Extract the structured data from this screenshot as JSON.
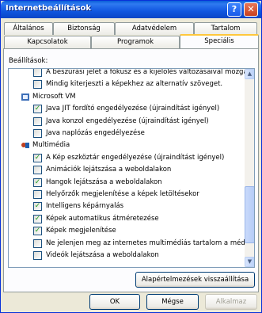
{
  "window": {
    "title": "Internetbeállítások"
  },
  "titlebar_buttons": {
    "help": "?",
    "close": "✕"
  },
  "tabs_row1": [
    "Általános",
    "Biztonság",
    "Adatvédelem",
    "Tartalom"
  ],
  "tabs_row2": [
    "Kapcsolatok",
    "Programok",
    "Speciális"
  ],
  "active_tab": "Speciális",
  "settings": {
    "label": "Beállítások:",
    "rows": [
      {
        "type": "checkbox",
        "checked": false,
        "text": "A beszúrási jelet a fókusz és a kijelölés változásaival mozgatja"
      },
      {
        "type": "checkbox",
        "checked": false,
        "text": "Mindig kiterjeszti a képekhez az alternatív szöveget."
      },
      {
        "type": "category",
        "icon": "java-icon",
        "text": "Microsoft VM"
      },
      {
        "type": "checkbox",
        "checked": true,
        "text": "Java JIT fordító engedélyezése (újraindítást igényel)"
      },
      {
        "type": "checkbox",
        "checked": false,
        "text": "Java konzol engedélyezése (újraindítást igényel)"
      },
      {
        "type": "checkbox",
        "checked": false,
        "text": "Java naplózás engedélyezése"
      },
      {
        "type": "category",
        "icon": "multimedia-icon",
        "text": "Multimédia"
      },
      {
        "type": "checkbox",
        "checked": true,
        "text": "A Kép eszköztár engedélyezése (újraindítást igényel)"
      },
      {
        "type": "checkbox",
        "checked": false,
        "text": "Animációk lejátszása a weboldalakon"
      },
      {
        "type": "checkbox",
        "checked": true,
        "text": "Hangok lejátszása a weboldalakon"
      },
      {
        "type": "checkbox",
        "checked": false,
        "text": "Helyőrzők megjelenítése a képek letöltésekor"
      },
      {
        "type": "checkbox",
        "checked": true,
        "text": "Intelligens képárnyalás"
      },
      {
        "type": "checkbox",
        "checked": true,
        "text": "Képek automatikus átméretezése"
      },
      {
        "type": "checkbox",
        "checked": true,
        "text": "Képek megjelenítése"
      },
      {
        "type": "checkbox",
        "checked": false,
        "text": "Ne jelenjen meg az internetes multimédiás tartalom a médiasz"
      },
      {
        "type": "checkbox",
        "checked": false,
        "text": "Videók lejátszása a weboldalakon"
      }
    ]
  },
  "scrollbar": {
    "up": "▲",
    "down": "▼"
  },
  "buttons": {
    "restore": "Alapértelmezések visszaállítása",
    "ok": "OK",
    "cancel": "Mégse",
    "apply": "Alkalmaz"
  },
  "colors": {
    "title_bar": "#0a5fd8",
    "active_tab_accent": "#ffc83c",
    "check": "#21a121"
  }
}
